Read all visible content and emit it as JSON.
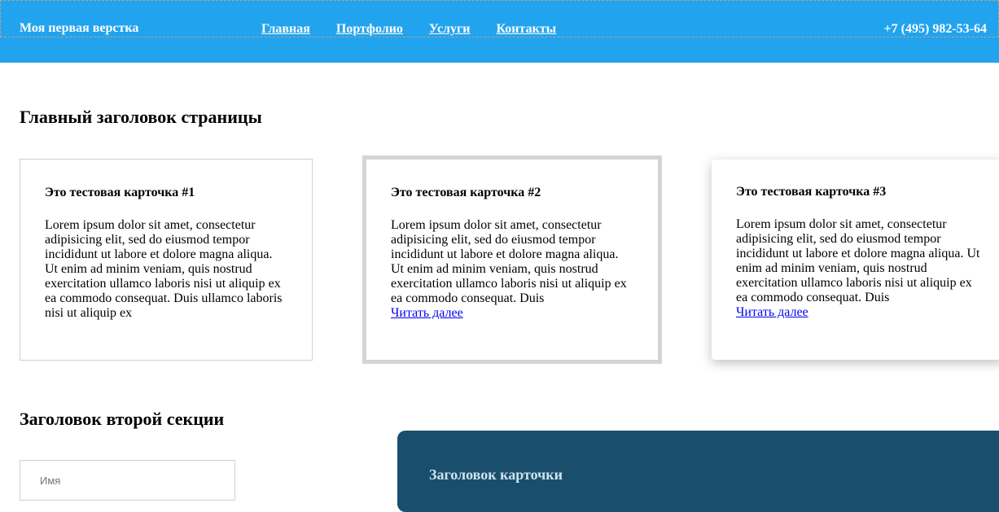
{
  "header": {
    "logo": "Моя первая верстка",
    "nav": [
      "Главная",
      "Портфолио",
      "Услуги",
      "Контакты"
    ],
    "phone": "+7 (495) 982-53-64",
    "background_color": "#22a3ee"
  },
  "main_title": "Главный заголовок страницы",
  "cards": [
    {
      "title": "Это тестовая карточка #1",
      "text": "Lorem ipsum dolor sit amet, consectetur adipisicing elit, sed do eiusmod tempor incididunt ut labore et dolore magna aliqua. Ut enim ad minim veniam, quis nostrud exercitation ullamco laboris nisi ut aliquip ex ea commodo consequat. Duis ullamco laboris nisi ut aliquip ex"
    },
    {
      "title": "Это тестовая карточка #2",
      "text": "Lorem ipsum dolor sit amet, consectetur adipisicing elit, sed do eiusmod tempor incididunt ut labore et dolore magna aliqua. Ut enim ad minim veniam, quis nostrud exercitation ullamco laboris nisi ut aliquip ex ea commodo consequat. Duis",
      "link": "Читать далее"
    },
    {
      "title": "Это тестовая карточка #3",
      "text": "Lorem ipsum dolor sit amet, consectetur adipisicing elit, sed do eiusmod tempor incididunt ut labore et dolore magna aliqua. Ut enim ad minim veniam, quis nostrud exercitation ullamco laboris nisi ut aliquip ex ea commodo consequat. Duis",
      "link": "Читать далее"
    }
  ],
  "second_section": {
    "title": "Заголовок второй секции",
    "name_placeholder": "Имя",
    "dark_card_title": "Заголовок карточки",
    "dark_card_color": "#194f6d"
  }
}
